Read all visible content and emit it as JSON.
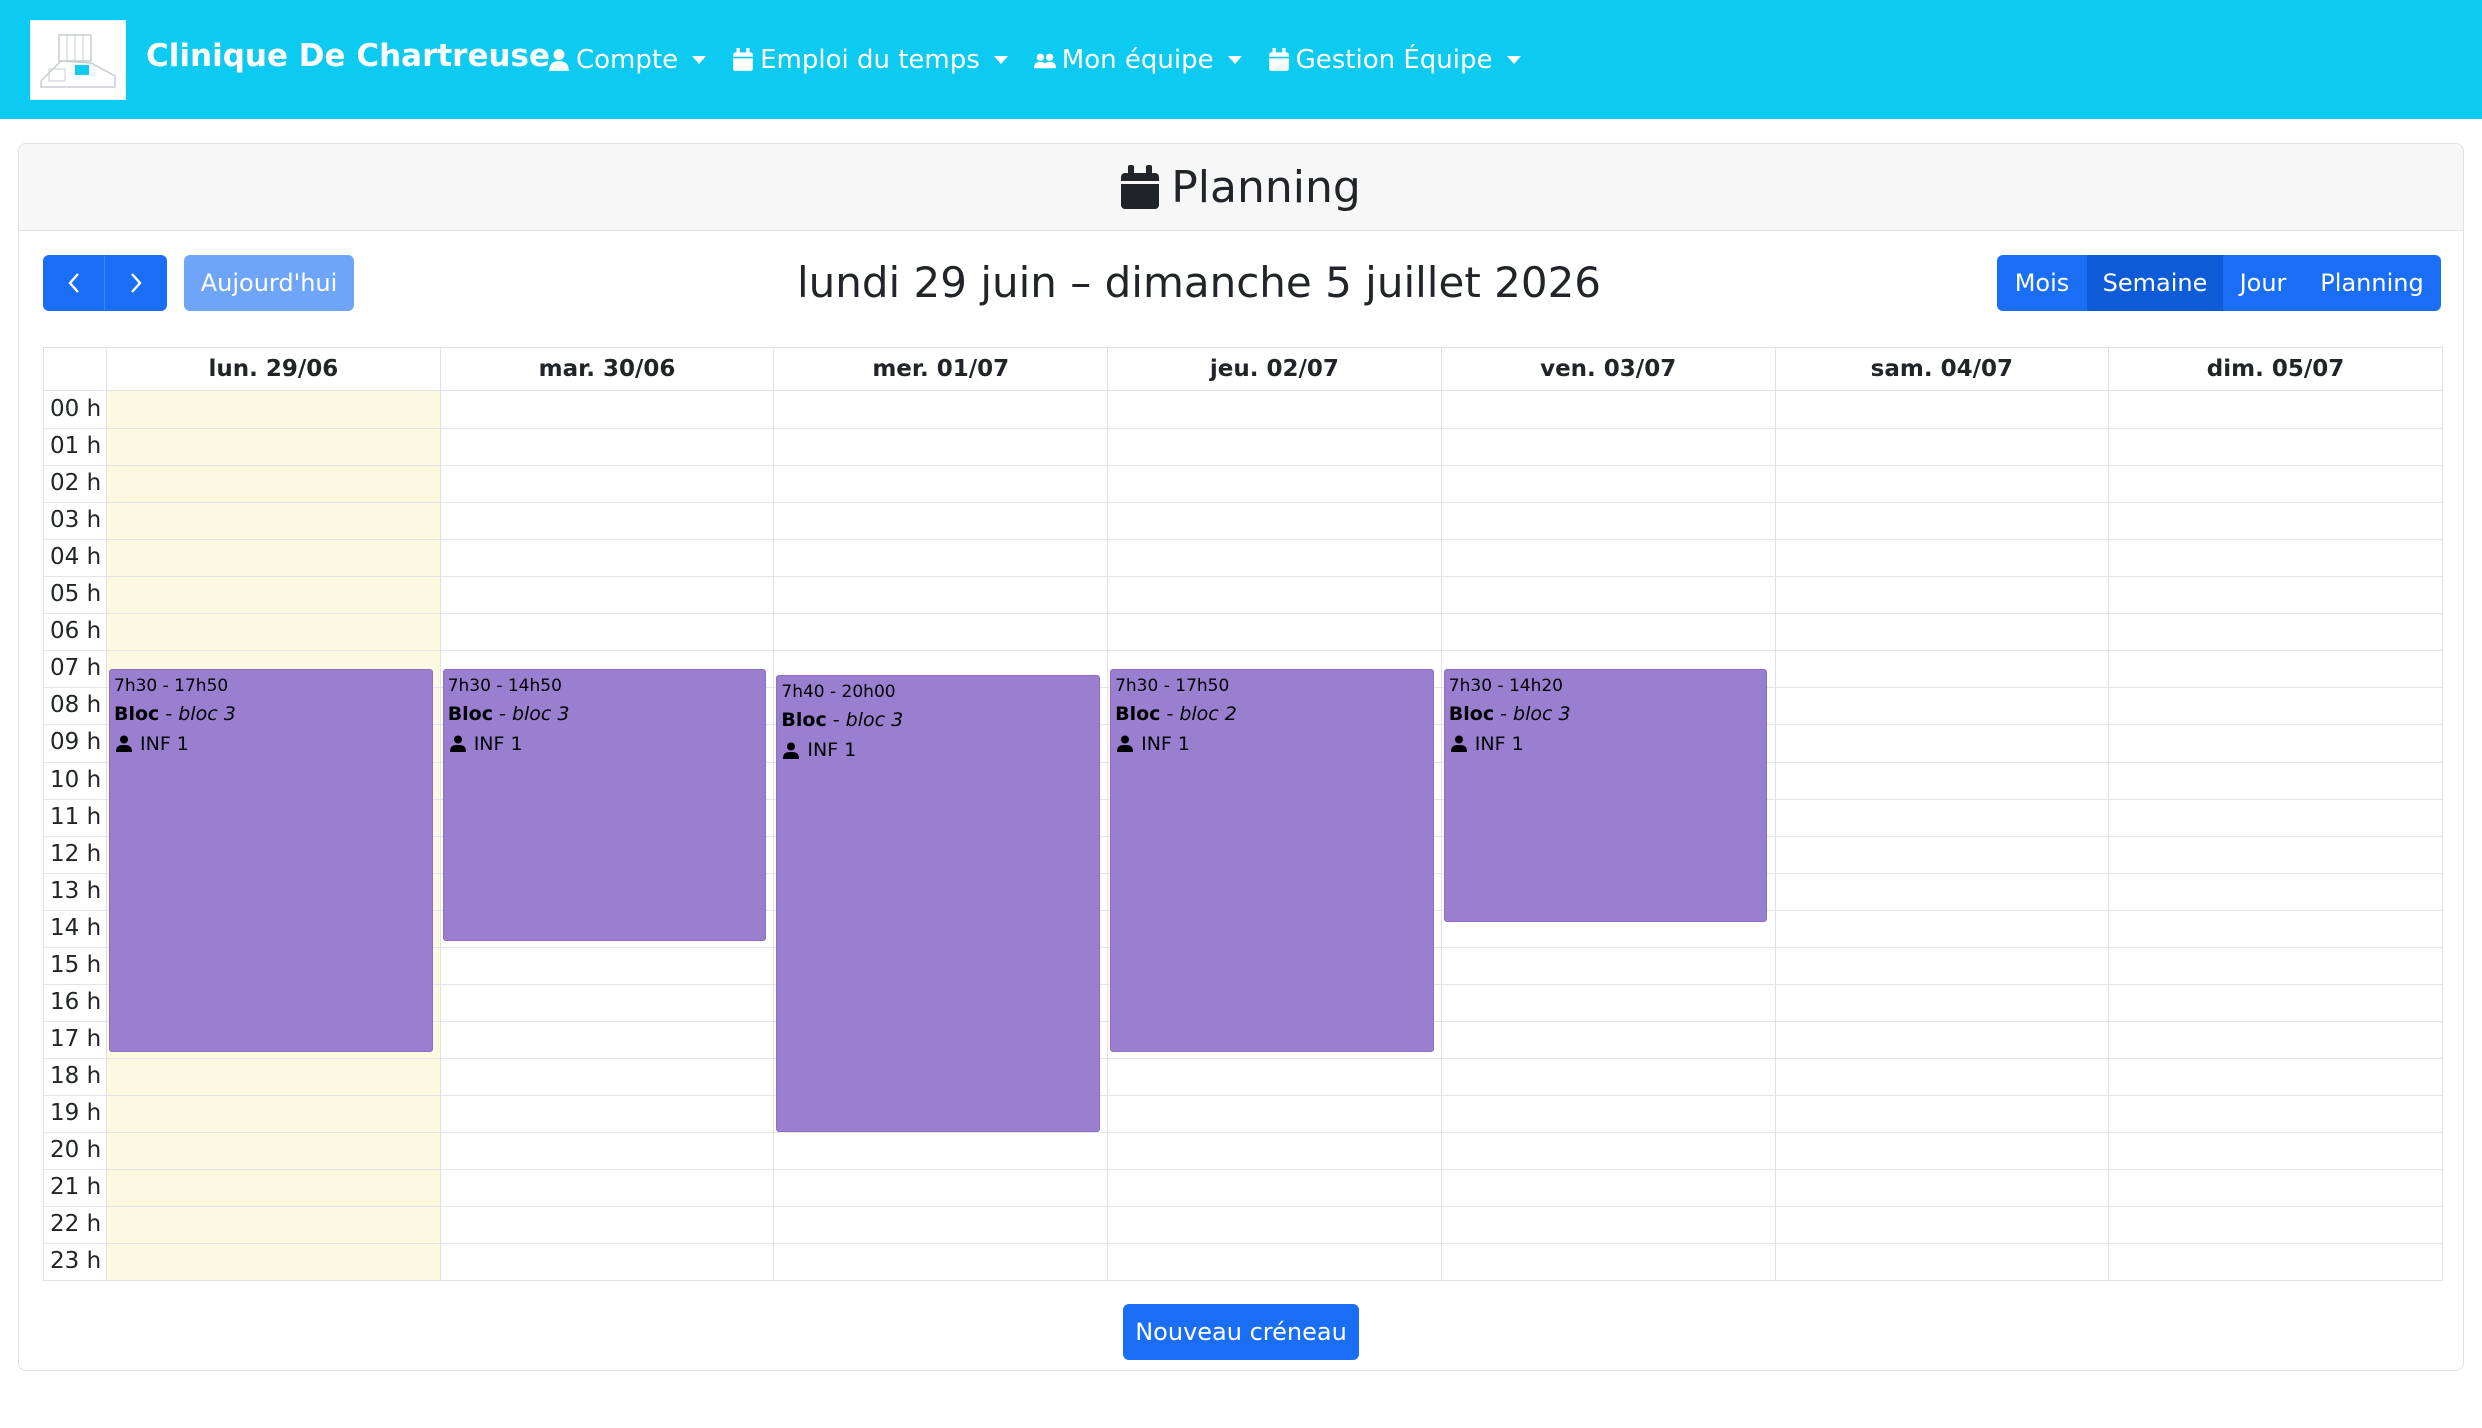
{
  "navbar": {
    "brand": "Clinique De Chartreuse",
    "accent": "#0dcaf0",
    "menu": [
      {
        "label": "Compte",
        "icon": "user-icon"
      },
      {
        "label": "Emploi du temps",
        "icon": "calendar-icon"
      },
      {
        "label": "Mon équipe",
        "icon": "users-icon"
      },
      {
        "label": "Gestion Équipe",
        "icon": "calendar-icon"
      }
    ]
  },
  "card": {
    "title": "Planning",
    "title_icon": "calendar-icon"
  },
  "toolbar": {
    "prev_icon": "chevron-left-icon",
    "next_icon": "chevron-right-icon",
    "today_label": "Aujourd'hui",
    "range_title": "lundi 29 juin – dimanche 5 juillet 2026",
    "views": [
      {
        "label": "Mois",
        "active": false
      },
      {
        "label": "Semaine",
        "active": true
      },
      {
        "label": "Jour",
        "active": false
      },
      {
        "label": "Planning",
        "active": false
      }
    ]
  },
  "calendar": {
    "days": [
      "lun. 29/06",
      "mar. 30/06",
      "mer. 01/07",
      "jeu. 02/07",
      "ven. 03/07",
      "sam. 04/07",
      "dim. 05/07"
    ],
    "today_index": 0,
    "hours": [
      "00 h",
      "01 h",
      "02 h",
      "03 h",
      "04 h",
      "05 h",
      "06 h",
      "07 h",
      "08 h",
      "09 h",
      "10 h",
      "11 h",
      "12 h",
      "13 h",
      "14 h",
      "15 h",
      "16 h",
      "17 h",
      "18 h",
      "19 h",
      "20 h",
      "21 h",
      "22 h",
      "23 h"
    ],
    "event_color": "#9a7ed0",
    "events": [
      {
        "day": 0,
        "start": 7.5,
        "end": 17.8333,
        "time": "7h30 - 17h50",
        "title": "Bloc",
        "location": "bloc 3",
        "staff": "INF 1"
      },
      {
        "day": 1,
        "start": 7.5,
        "end": 14.8333,
        "time": "7h30 - 14h50",
        "title": "Bloc",
        "location": "bloc 3",
        "staff": "INF 1"
      },
      {
        "day": 2,
        "start": 7.6667,
        "end": 20.0,
        "time": "7h40 - 20h00",
        "title": "Bloc",
        "location": "bloc 3",
        "staff": "INF 1"
      },
      {
        "day": 3,
        "start": 7.5,
        "end": 17.8333,
        "time": "7h30 - 17h50",
        "title": "Bloc",
        "location": "bloc 2",
        "staff": "INF 1"
      },
      {
        "day": 4,
        "start": 7.5,
        "end": 14.3333,
        "time": "7h30 - 14h20",
        "title": "Bloc",
        "location": "bloc 3",
        "staff": "INF 1"
      }
    ]
  },
  "footer": {
    "new_slot_label": "Nouveau créneau"
  }
}
